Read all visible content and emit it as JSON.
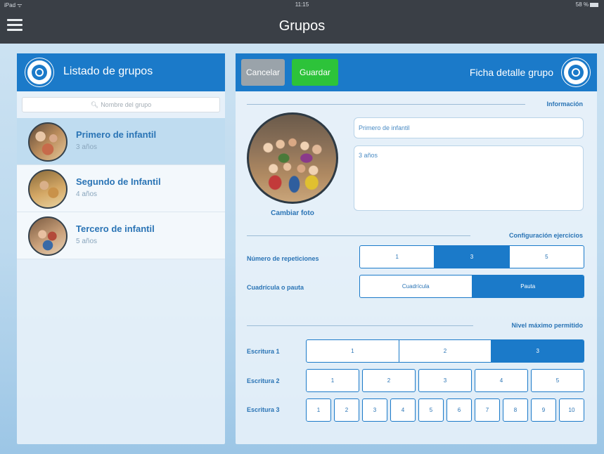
{
  "status_bar": {
    "left": "iPad ᯤ",
    "time": "11:15",
    "right": "58 %"
  },
  "nav": {
    "title": "Grupos"
  },
  "left_panel": {
    "title": "Listado de grupos",
    "search": {
      "placeholder": "Nombre del grupo"
    },
    "groups": [
      {
        "name": "Primero de infantil",
        "age": "3 años",
        "selected": true
      },
      {
        "name": "Segundo de Infantil",
        "age": "4 años",
        "selected": false
      },
      {
        "name": "Tercero de infantil",
        "age": "5 años",
        "selected": false
      }
    ]
  },
  "right_panel": {
    "title": "Ficha detalle grupo",
    "cancel_label": "Cancelar",
    "save_label": "Guardar",
    "info_section": "Información",
    "change_photo": "Cambiar foto",
    "name_value": "Primero de infantil",
    "description_value": "3 años",
    "config_section": "Configuración ejercicios",
    "repetitions": {
      "label": "Número de repeticiones",
      "options": [
        "1",
        "3",
        "5"
      ],
      "selected": "3"
    },
    "grid": {
      "label": "Cuadrícula o pauta",
      "options": [
        "Cuadrícula",
        "Pauta"
      ],
      "selected": "Pauta"
    },
    "level_section": "Nivel máximo permitido",
    "escritura1": {
      "label": "Escritura 1",
      "options": [
        "1",
        "2",
        "3"
      ],
      "selected": "3"
    },
    "escritura2": {
      "label": "Escritura 2",
      "options": [
        "1",
        "2",
        "3",
        "4",
        "5"
      ],
      "selected": ""
    },
    "escritura3": {
      "label": "Escritura 3",
      "options": [
        "1",
        "2",
        "3",
        "4",
        "5",
        "6",
        "7",
        "8",
        "9",
        "10"
      ],
      "selected": ""
    }
  },
  "colors": {
    "accent": "#1b7ac9",
    "save": "#2dc33a",
    "cancel": "#9aa3aa",
    "navbar": "#3a3f46"
  }
}
